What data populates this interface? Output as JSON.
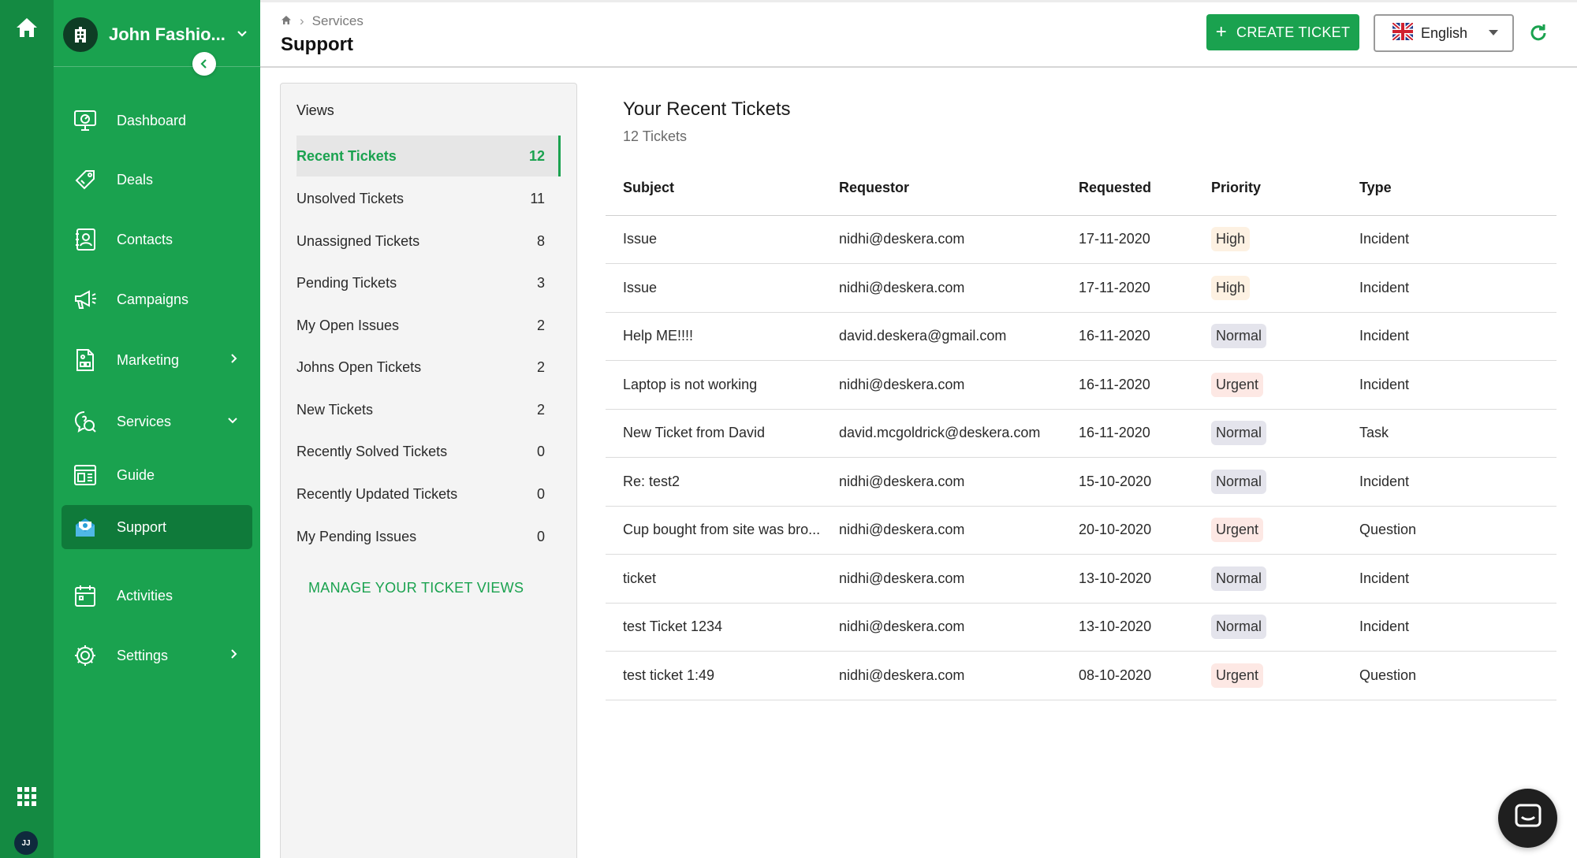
{
  "org": {
    "name": "John Fashio..."
  },
  "user": {
    "initials": "JJ"
  },
  "nav": [
    {
      "label": "Dashboard",
      "icon": "dashboard-icon"
    },
    {
      "label": "Deals",
      "icon": "deals-icon"
    },
    {
      "label": "Contacts",
      "icon": "contacts-icon"
    },
    {
      "label": "Campaigns",
      "icon": "megaphone-icon"
    },
    {
      "label": "Marketing",
      "icon": "marketing-icon"
    },
    {
      "label": "Services",
      "icon": "services-icon"
    },
    {
      "label": "Guide",
      "icon": "guide-icon"
    },
    {
      "label": "Support",
      "icon": "support-icon"
    },
    {
      "label": "Activities",
      "icon": "calendar-icon"
    },
    {
      "label": "Settings",
      "icon": "gear-icon"
    }
  ],
  "header": {
    "breadcrumb": "Services",
    "title": "Support",
    "create_label": "CREATE TICKET",
    "language": "English"
  },
  "views": {
    "title": "Views",
    "items": [
      {
        "label": "Recent Tickets",
        "count": "12"
      },
      {
        "label": "Unsolved Tickets",
        "count": "11"
      },
      {
        "label": "Unassigned Tickets",
        "count": "8"
      },
      {
        "label": "Pending Tickets",
        "count": "3"
      },
      {
        "label": "My Open Issues",
        "count": "2"
      },
      {
        "label": "Johns Open Tickets",
        "count": "2"
      },
      {
        "label": "New Tickets",
        "count": "2"
      },
      {
        "label": "Recently Solved Tickets",
        "count": "0"
      },
      {
        "label": "Recently Updated Tickets",
        "count": "0"
      },
      {
        "label": "My Pending Issues",
        "count": "0"
      }
    ],
    "manage_label": "MANAGE YOUR TICKET VIEWS"
  },
  "tickets": {
    "title": "Your Recent Tickets",
    "count_label": "12 Tickets",
    "columns": [
      "Subject",
      "Requestor",
      "Requested",
      "Priority",
      "Type"
    ],
    "rows": [
      {
        "subject": "Issue",
        "requestor": "nidhi@deskera.com",
        "requested": "17-11-2020",
        "priority": "High",
        "type": "Incident"
      },
      {
        "subject": "Issue",
        "requestor": "nidhi@deskera.com",
        "requested": "17-11-2020",
        "priority": "High",
        "type": "Incident"
      },
      {
        "subject": "Help ME!!!!",
        "requestor": "david.deskera@gmail.com",
        "requested": "16-11-2020",
        "priority": "Normal",
        "type": "Incident"
      },
      {
        "subject": "Laptop is not working",
        "requestor": "nidhi@deskera.com",
        "requested": "16-11-2020",
        "priority": "Urgent",
        "type": "Incident"
      },
      {
        "subject": "New Ticket from David",
        "requestor": "david.mcgoldrick@deskera.com",
        "requested": "16-11-2020",
        "priority": "Normal",
        "type": "Task"
      },
      {
        "subject": "Re: test2",
        "requestor": "nidhi@deskera.com",
        "requested": "15-10-2020",
        "priority": "Normal",
        "type": "Incident"
      },
      {
        "subject": "Cup bought from site was bro...",
        "requestor": "nidhi@deskera.com",
        "requested": "20-10-2020",
        "priority": "Urgent",
        "type": "Question"
      },
      {
        "subject": "ticket",
        "requestor": "nidhi@deskera.com",
        "requested": "13-10-2020",
        "priority": "Normal",
        "type": "Incident"
      },
      {
        "subject": "test Ticket 1234",
        "requestor": "nidhi@deskera.com",
        "requested": "13-10-2020",
        "priority": "Normal",
        "type": "Incident"
      },
      {
        "subject": "test ticket 1:49",
        "requestor": "nidhi@deskera.com",
        "requested": "08-10-2020",
        "priority": "Urgent",
        "type": "Question"
      }
    ]
  },
  "colors": {
    "brand_green": "#1aa24f",
    "rail_green": "#148a42",
    "active_nav": "#0f7a3a"
  }
}
